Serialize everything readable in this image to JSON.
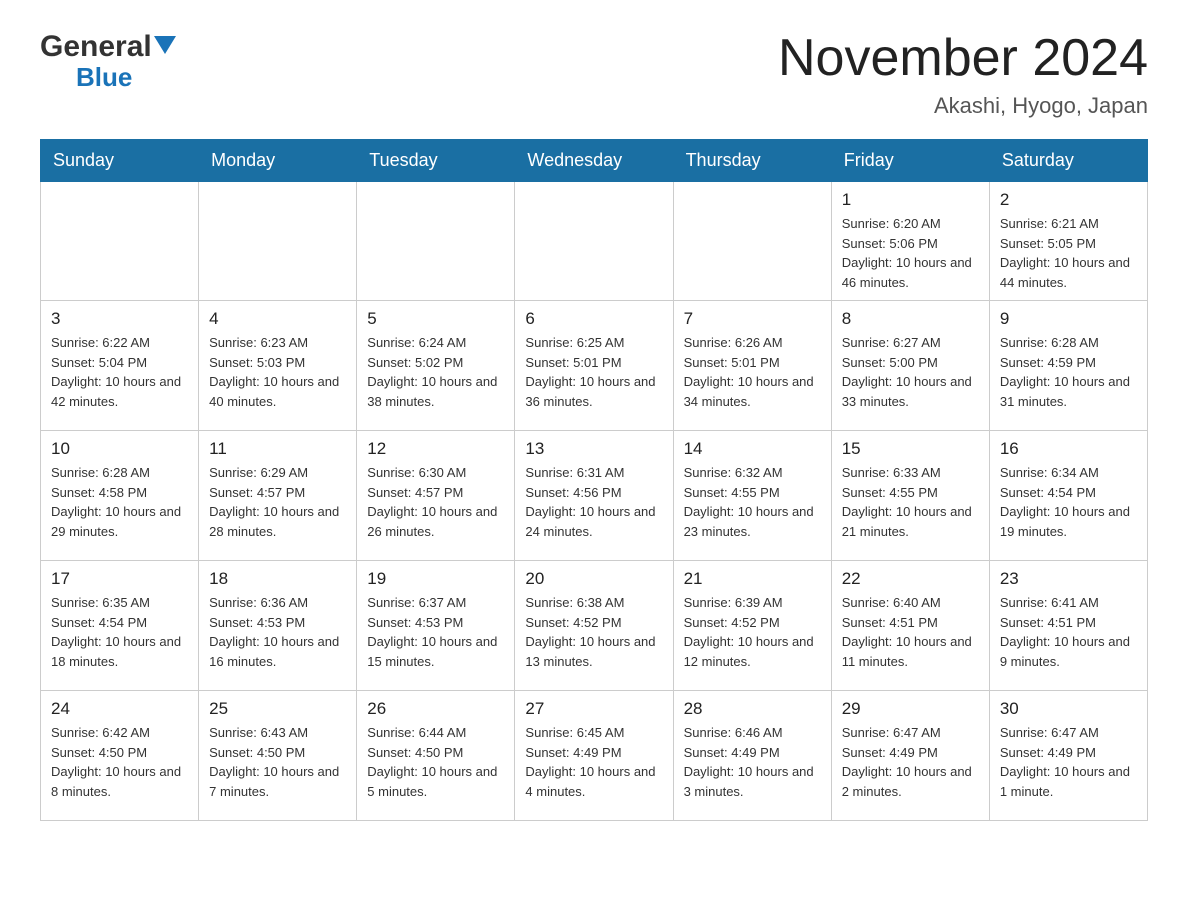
{
  "logo": {
    "general": "General",
    "blue": "Blue"
  },
  "header": {
    "title": "November 2024",
    "subtitle": "Akashi, Hyogo, Japan"
  },
  "weekdays": [
    "Sunday",
    "Monday",
    "Tuesday",
    "Wednesday",
    "Thursday",
    "Friday",
    "Saturday"
  ],
  "weeks": [
    [
      {
        "day": "",
        "info": ""
      },
      {
        "day": "",
        "info": ""
      },
      {
        "day": "",
        "info": ""
      },
      {
        "day": "",
        "info": ""
      },
      {
        "day": "",
        "info": ""
      },
      {
        "day": "1",
        "info": "Sunrise: 6:20 AM\nSunset: 5:06 PM\nDaylight: 10 hours and 46 minutes."
      },
      {
        "day": "2",
        "info": "Sunrise: 6:21 AM\nSunset: 5:05 PM\nDaylight: 10 hours and 44 minutes."
      }
    ],
    [
      {
        "day": "3",
        "info": "Sunrise: 6:22 AM\nSunset: 5:04 PM\nDaylight: 10 hours and 42 minutes."
      },
      {
        "day": "4",
        "info": "Sunrise: 6:23 AM\nSunset: 5:03 PM\nDaylight: 10 hours and 40 minutes."
      },
      {
        "day": "5",
        "info": "Sunrise: 6:24 AM\nSunset: 5:02 PM\nDaylight: 10 hours and 38 minutes."
      },
      {
        "day": "6",
        "info": "Sunrise: 6:25 AM\nSunset: 5:01 PM\nDaylight: 10 hours and 36 minutes."
      },
      {
        "day": "7",
        "info": "Sunrise: 6:26 AM\nSunset: 5:01 PM\nDaylight: 10 hours and 34 minutes."
      },
      {
        "day": "8",
        "info": "Sunrise: 6:27 AM\nSunset: 5:00 PM\nDaylight: 10 hours and 33 minutes."
      },
      {
        "day": "9",
        "info": "Sunrise: 6:28 AM\nSunset: 4:59 PM\nDaylight: 10 hours and 31 minutes."
      }
    ],
    [
      {
        "day": "10",
        "info": "Sunrise: 6:28 AM\nSunset: 4:58 PM\nDaylight: 10 hours and 29 minutes."
      },
      {
        "day": "11",
        "info": "Sunrise: 6:29 AM\nSunset: 4:57 PM\nDaylight: 10 hours and 28 minutes."
      },
      {
        "day": "12",
        "info": "Sunrise: 6:30 AM\nSunset: 4:57 PM\nDaylight: 10 hours and 26 minutes."
      },
      {
        "day": "13",
        "info": "Sunrise: 6:31 AM\nSunset: 4:56 PM\nDaylight: 10 hours and 24 minutes."
      },
      {
        "day": "14",
        "info": "Sunrise: 6:32 AM\nSunset: 4:55 PM\nDaylight: 10 hours and 23 minutes."
      },
      {
        "day": "15",
        "info": "Sunrise: 6:33 AM\nSunset: 4:55 PM\nDaylight: 10 hours and 21 minutes."
      },
      {
        "day": "16",
        "info": "Sunrise: 6:34 AM\nSunset: 4:54 PM\nDaylight: 10 hours and 19 minutes."
      }
    ],
    [
      {
        "day": "17",
        "info": "Sunrise: 6:35 AM\nSunset: 4:54 PM\nDaylight: 10 hours and 18 minutes."
      },
      {
        "day": "18",
        "info": "Sunrise: 6:36 AM\nSunset: 4:53 PM\nDaylight: 10 hours and 16 minutes."
      },
      {
        "day": "19",
        "info": "Sunrise: 6:37 AM\nSunset: 4:53 PM\nDaylight: 10 hours and 15 minutes."
      },
      {
        "day": "20",
        "info": "Sunrise: 6:38 AM\nSunset: 4:52 PM\nDaylight: 10 hours and 13 minutes."
      },
      {
        "day": "21",
        "info": "Sunrise: 6:39 AM\nSunset: 4:52 PM\nDaylight: 10 hours and 12 minutes."
      },
      {
        "day": "22",
        "info": "Sunrise: 6:40 AM\nSunset: 4:51 PM\nDaylight: 10 hours and 11 minutes."
      },
      {
        "day": "23",
        "info": "Sunrise: 6:41 AM\nSunset: 4:51 PM\nDaylight: 10 hours and 9 minutes."
      }
    ],
    [
      {
        "day": "24",
        "info": "Sunrise: 6:42 AM\nSunset: 4:50 PM\nDaylight: 10 hours and 8 minutes."
      },
      {
        "day": "25",
        "info": "Sunrise: 6:43 AM\nSunset: 4:50 PM\nDaylight: 10 hours and 7 minutes."
      },
      {
        "day": "26",
        "info": "Sunrise: 6:44 AM\nSunset: 4:50 PM\nDaylight: 10 hours and 5 minutes."
      },
      {
        "day": "27",
        "info": "Sunrise: 6:45 AM\nSunset: 4:49 PM\nDaylight: 10 hours and 4 minutes."
      },
      {
        "day": "28",
        "info": "Sunrise: 6:46 AM\nSunset: 4:49 PM\nDaylight: 10 hours and 3 minutes."
      },
      {
        "day": "29",
        "info": "Sunrise: 6:47 AM\nSunset: 4:49 PM\nDaylight: 10 hours and 2 minutes."
      },
      {
        "day": "30",
        "info": "Sunrise: 6:47 AM\nSunset: 4:49 PM\nDaylight: 10 hours and 1 minute."
      }
    ]
  ],
  "colors": {
    "header_bg": "#1a6fa3",
    "header_text": "#ffffff",
    "border": "#aaaaaa",
    "cell_border": "#cccccc"
  }
}
